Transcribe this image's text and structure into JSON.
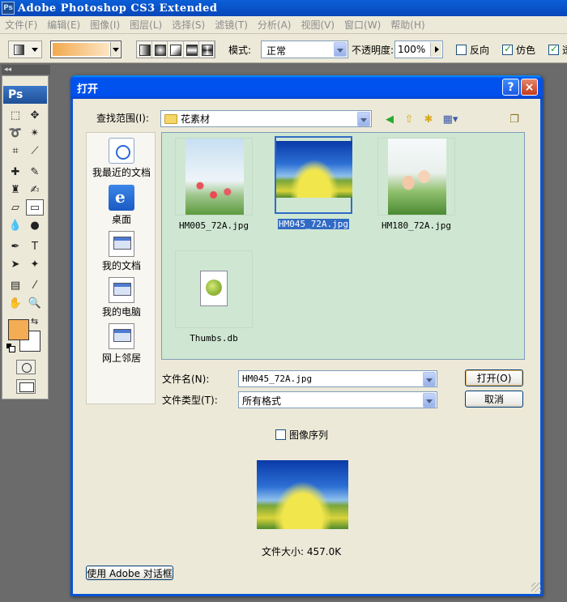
{
  "app": {
    "title": "Adobe Photoshop CS3 Extended",
    "icon": "Ps"
  },
  "menu": [
    "文件(F)",
    "编辑(E)",
    "图像(I)",
    "图层(L)",
    "选择(S)",
    "滤镜(T)",
    "分析(A)",
    "视图(V)",
    "窗口(W)",
    "帮助(H)"
  ],
  "options": {
    "mode_label": "模式:",
    "mode_value": "正常",
    "opacity_label": "不透明度:",
    "opacity_value": "100%",
    "reverse_label": "反向",
    "reverse_checked": false,
    "dither_label": "仿色",
    "dither_checked": true,
    "transparency_label": "透",
    "transparency_checked": true
  },
  "toolbox": {
    "logo": "Ps",
    "foreground_color": "#f4ac55",
    "background_color": "#ffffff"
  },
  "dialog": {
    "title": "打开",
    "help_btn": "?",
    "close_btn": "×",
    "lookin_label": "查找范围(I):",
    "lookin_value": "花素材",
    "places": [
      {
        "label": "我最近的文档",
        "icon": "recent-docs-icon"
      },
      {
        "label": "桌面",
        "icon": "desktop-icon"
      },
      {
        "label": "我的文档",
        "icon": "my-documents-icon"
      },
      {
        "label": "我的电脑",
        "icon": "my-computer-icon"
      },
      {
        "label": "网上邻居",
        "icon": "network-icon"
      }
    ],
    "files": [
      {
        "name": "HM005_72A.jpg",
        "selected": false
      },
      {
        "name": "HM045_72A.jpg",
        "selected": true
      },
      {
        "name": "HM180_72A.jpg",
        "selected": false
      },
      {
        "name": "Thumbs.db",
        "selected": false
      }
    ],
    "filename_label": "文件名(N):",
    "filename_value": "HM045_72A.jpg",
    "filetype_label": "文件类型(T):",
    "filetype_value": "所有格式",
    "open_btn": "打开(O)",
    "cancel_btn": "取消",
    "sequence_label": "图像序列",
    "sequence_checked": false,
    "filesize": "文件大小: 457.0K",
    "adobe_dialog_btn": "使用 Adobe 对话框"
  }
}
